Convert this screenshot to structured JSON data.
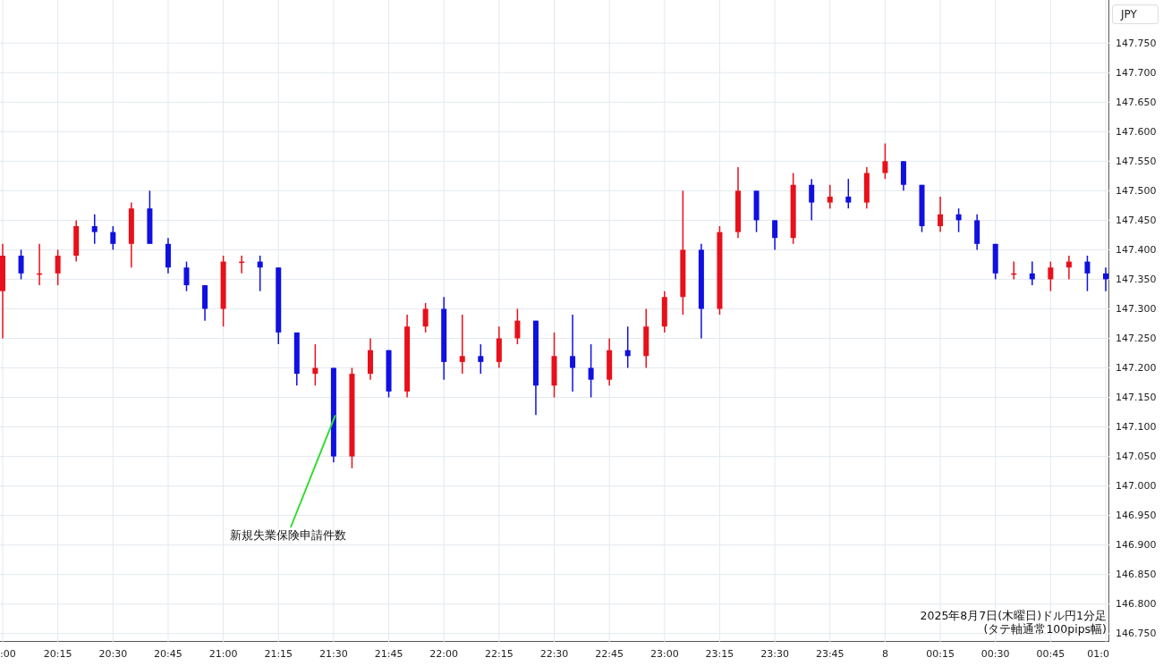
{
  "currency_button": "JPY",
  "caption": [
    "2025年8月7日(木曜日)ドル円1分足",
    "(タテ軸通常100pips幅)"
  ],
  "chart_data": {
    "type": "candlestick",
    "categories": [
      ":00",
      null,
      null,
      "20:15",
      null,
      null,
      "20:30",
      null,
      null,
      "20:45",
      null,
      null,
      "21:00",
      null,
      null,
      "21:15",
      null,
      null,
      "21:30",
      null,
      null,
      "21:45",
      null,
      null,
      "22:00",
      null,
      null,
      "22:15",
      null,
      null,
      "22:30",
      null,
      null,
      "22:45",
      null,
      null,
      "23:00",
      null,
      null,
      "23:15",
      null,
      null,
      "23:30",
      null,
      null,
      "23:45",
      null,
      null,
      "8",
      null,
      null,
      "00:15",
      null,
      null,
      "00:30",
      null,
      null,
      "00:45",
      null,
      null,
      "01:0"
    ],
    "ohlc": [
      [
        147.33,
        147.41,
        147.25,
        147.39
      ],
      [
        147.39,
        147.4,
        147.35,
        147.36
      ],
      [
        147.36,
        147.41,
        147.34,
        147.36
      ],
      [
        147.36,
        147.4,
        147.34,
        147.39
      ],
      [
        147.39,
        147.45,
        147.38,
        147.44
      ],
      [
        147.44,
        147.46,
        147.41,
        147.43
      ],
      [
        147.43,
        147.44,
        147.4,
        147.41
      ],
      [
        147.41,
        147.48,
        147.37,
        147.47
      ],
      [
        147.47,
        147.5,
        147.41,
        147.41
      ],
      [
        147.41,
        147.42,
        147.36,
        147.37
      ],
      [
        147.37,
        147.38,
        147.33,
        147.34
      ],
      [
        147.34,
        147.34,
        147.28,
        147.3
      ],
      [
        147.3,
        147.39,
        147.27,
        147.38
      ],
      [
        147.38,
        147.39,
        147.36,
        147.38
      ],
      [
        147.38,
        147.39,
        147.33,
        147.37
      ],
      [
        147.37,
        147.37,
        147.24,
        147.26
      ],
      [
        147.26,
        147.26,
        147.17,
        147.19
      ],
      [
        147.19,
        147.24,
        147.17,
        147.2
      ],
      [
        147.2,
        147.2,
        147.04,
        147.05
      ],
      [
        147.05,
        147.2,
        147.03,
        147.19
      ],
      [
        147.19,
        147.25,
        147.18,
        147.23
      ],
      [
        147.23,
        147.23,
        147.15,
        147.16
      ],
      [
        147.16,
        147.29,
        147.15,
        147.27
      ],
      [
        147.27,
        147.31,
        147.26,
        147.3
      ],
      [
        147.3,
        147.32,
        147.18,
        147.21
      ],
      [
        147.21,
        147.29,
        147.19,
        147.22
      ],
      [
        147.22,
        147.24,
        147.19,
        147.21
      ],
      [
        147.21,
        147.27,
        147.2,
        147.25
      ],
      [
        147.25,
        147.3,
        147.24,
        147.28
      ],
      [
        147.28,
        147.28,
        147.12,
        147.17
      ],
      [
        147.17,
        147.26,
        147.15,
        147.22
      ],
      [
        147.22,
        147.29,
        147.16,
        147.2
      ],
      [
        147.2,
        147.24,
        147.15,
        147.18
      ],
      [
        147.18,
        147.25,
        147.17,
        147.23
      ],
      [
        147.23,
        147.27,
        147.2,
        147.22
      ],
      [
        147.22,
        147.3,
        147.2,
        147.27
      ],
      [
        147.27,
        147.33,
        147.26,
        147.32
      ],
      [
        147.32,
        147.5,
        147.29,
        147.4
      ],
      [
        147.4,
        147.41,
        147.25,
        147.3
      ],
      [
        147.3,
        147.44,
        147.29,
        147.43
      ],
      [
        147.43,
        147.54,
        147.42,
        147.5
      ],
      [
        147.5,
        147.5,
        147.43,
        147.45
      ],
      [
        147.45,
        147.45,
        147.4,
        147.42
      ],
      [
        147.42,
        147.53,
        147.41,
        147.51
      ],
      [
        147.51,
        147.52,
        147.45,
        147.48
      ],
      [
        147.48,
        147.51,
        147.47,
        147.49
      ],
      [
        147.49,
        147.52,
        147.47,
        147.48
      ],
      [
        147.48,
        147.54,
        147.47,
        147.53
      ],
      [
        147.53,
        147.58,
        147.52,
        147.55
      ],
      [
        147.55,
        147.55,
        147.5,
        147.51
      ],
      [
        147.51,
        147.51,
        147.43,
        147.44
      ],
      [
        147.44,
        147.49,
        147.43,
        147.46
      ],
      [
        147.46,
        147.47,
        147.43,
        147.45
      ],
      [
        147.45,
        147.46,
        147.4,
        147.41
      ],
      [
        147.41,
        147.41,
        147.35,
        147.36
      ],
      [
        147.36,
        147.38,
        147.35,
        147.36
      ],
      [
        147.36,
        147.38,
        147.34,
        147.35
      ],
      [
        147.35,
        147.38,
        147.33,
        147.37
      ],
      [
        147.37,
        147.39,
        147.35,
        147.38
      ],
      [
        147.38,
        147.39,
        147.33,
        147.36
      ],
      [
        147.36,
        147.37,
        147.33,
        147.35
      ]
    ],
    "ylim": [
      146.736,
      147.823
    ],
    "yticks": [
      {
        "value": 147.75,
        "label": "147.750"
      },
      {
        "value": 147.7,
        "label": "147.700"
      },
      {
        "value": 147.65,
        "label": "147.650"
      },
      {
        "value": 147.6,
        "label": "147.600"
      },
      {
        "value": 147.55,
        "label": "147.550"
      },
      {
        "value": 147.5,
        "label": "147.500"
      },
      {
        "value": 147.45,
        "label": "147.450"
      },
      {
        "value": 147.4,
        "label": "147.400"
      },
      {
        "value": 147.35,
        "label": "147.350"
      },
      {
        "value": 147.3,
        "label": "147.300"
      },
      {
        "value": 147.25,
        "label": "147.250"
      },
      {
        "value": 147.2,
        "label": "147.200"
      },
      {
        "value": 147.15,
        "label": "147.150"
      },
      {
        "value": 147.1,
        "label": "147.100"
      },
      {
        "value": 147.05,
        "label": "147.050"
      },
      {
        "value": 147.0,
        "label": "147.000"
      },
      {
        "value": 146.95,
        "label": "146.950"
      },
      {
        "value": 146.9,
        "label": "146.900"
      },
      {
        "value": 146.85,
        "label": "146.850"
      },
      {
        "value": 146.8,
        "label": "146.800"
      },
      {
        "value": 146.75,
        "label": "146.750"
      }
    ],
    "grid": true,
    "annotations": [
      {
        "text": "新規失業保険申請件数",
        "x": "21:30",
        "y": 147.12
      }
    ]
  }
}
